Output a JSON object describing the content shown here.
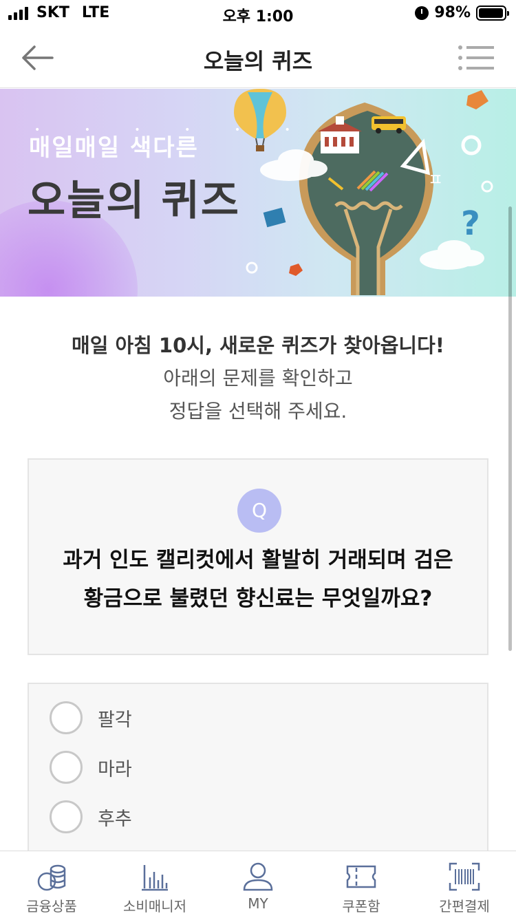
{
  "status_bar": {
    "carrier": "SKT",
    "network": "LTE",
    "time": "오후 1:00",
    "battery": "98%"
  },
  "header": {
    "title": "오늘의 퀴즈"
  },
  "banner": {
    "subtitle": "매일매일 색다른",
    "title": "오늘의 퀴즈"
  },
  "intro": {
    "bold_line": "매일 아침 10시, 새로운 퀴즈가 찾아옵니다!",
    "line2": "아래의 문제를 확인하고",
    "line3": "정답을 선택해 주세요."
  },
  "question": {
    "badge": "Q",
    "line1": "과거 인도 캘리컷에서 활발히 거래되며 검은",
    "line2": "황금으로 불렸던 향신료는 무엇일까요?"
  },
  "options": [
    {
      "label": "팔각"
    },
    {
      "label": "마라"
    },
    {
      "label": "후추"
    }
  ],
  "tab_bar": {
    "items": [
      {
        "label": "금융상품",
        "icon": "coins-icon"
      },
      {
        "label": "소비매니저",
        "icon": "bar-chart-icon"
      },
      {
        "label": "MY",
        "icon": "person-icon"
      },
      {
        "label": "쿠폰함",
        "icon": "ticket-icon"
      },
      {
        "label": "간편결제",
        "icon": "barcode-icon"
      }
    ]
  }
}
